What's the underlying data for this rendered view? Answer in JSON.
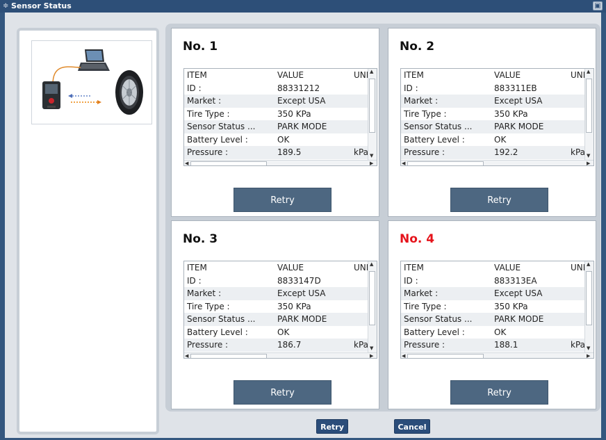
{
  "window": {
    "title": "Sensor Status",
    "icon": "sensor-icon"
  },
  "illustration": {
    "alt": ""
  },
  "cards": [
    {
      "title": "No. 1",
      "highlight": false,
      "headers": [
        "ITEM",
        "VALUE",
        "UNIT"
      ],
      "rows": [
        [
          "ID :",
          "88331212",
          ""
        ],
        [
          "Market :",
          "Except USA",
          ""
        ],
        [
          "Tire Type :",
          "350 KPa",
          ""
        ],
        [
          "Sensor Status ...",
          "PARK MODE",
          ""
        ],
        [
          "Battery Level :",
          "OK",
          ""
        ],
        [
          "Pressure :",
          "189.5",
          "kPa"
        ]
      ],
      "retry": "Retry"
    },
    {
      "title": "No. 2",
      "highlight": false,
      "headers": [
        "ITEM",
        "VALUE",
        "UNIT"
      ],
      "rows": [
        [
          "ID :",
          "883311EB",
          ""
        ],
        [
          "Market :",
          "Except USA",
          ""
        ],
        [
          "Tire Type :",
          "350 KPa",
          ""
        ],
        [
          "Sensor Status ...",
          "PARK MODE",
          ""
        ],
        [
          "Battery Level :",
          "OK",
          ""
        ],
        [
          "Pressure :",
          "192.2",
          "kPa"
        ]
      ],
      "retry": "Retry"
    },
    {
      "title": "No. 3",
      "highlight": false,
      "headers": [
        "ITEM",
        "VALUE",
        "UNIT"
      ],
      "rows": [
        [
          "ID :",
          "8833147D",
          ""
        ],
        [
          "Market :",
          "Except USA",
          ""
        ],
        [
          "Tire Type :",
          "350 KPa",
          ""
        ],
        [
          "Sensor Status ...",
          "PARK MODE",
          ""
        ],
        [
          "Battery Level :",
          "OK",
          ""
        ],
        [
          "Pressure :",
          "186.7",
          "kPa"
        ]
      ],
      "retry": "Retry"
    },
    {
      "title": "No. 4",
      "highlight": true,
      "headers": [
        "ITEM",
        "VALUE",
        "UNIT"
      ],
      "rows": [
        [
          "ID :",
          "883313EA",
          ""
        ],
        [
          "Market :",
          "Except USA",
          ""
        ],
        [
          "Tire Type :",
          "350 KPa",
          ""
        ],
        [
          "Sensor Status ...",
          "PARK MODE",
          ""
        ],
        [
          "Battery Level :",
          "OK",
          ""
        ],
        [
          "Pressure :",
          "188.1",
          "kPa"
        ]
      ],
      "retry": "Retry"
    }
  ],
  "footer": {
    "retry": "Retry",
    "cancel": "Cancel"
  },
  "colors": {
    "titlebar": "#2d4f78",
    "alert": "#e5141c",
    "button": "#4d6781"
  }
}
